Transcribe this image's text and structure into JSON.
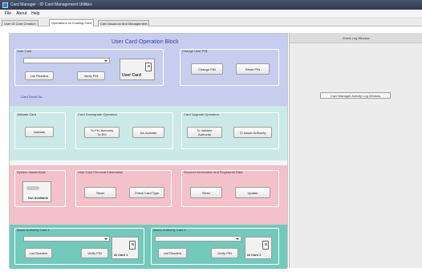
{
  "window": {
    "title": "Card Manager - ID Card Management Utilities"
  },
  "menu": [
    "File",
    "About",
    "Help"
  ],
  "tabs": [
    {
      "label": "User ID Card Creation"
    },
    {
      "label": "Operations on Existing Card"
    },
    {
      "label": "Card Issuance And Management"
    }
  ],
  "user_block": {
    "heading": "User Card Operation Block",
    "user_card_group": "User Card",
    "card_reader_value": "",
    "list_readers": "List Readers",
    "verify_pin": "Verify PIN",
    "card_image_label": "User Card",
    "card_serial": "Card Serial No.",
    "change_pin_group": "Change User PIN",
    "change_pin": "Change PIN",
    "reset_pin": "Reset PIN"
  },
  "validate_block": {
    "validate_group": "Validate Card",
    "validate": "Validate",
    "downgrade_group": "Card Downgrade Operation",
    "to_ra": "To PKI Authority\nTo RO",
    "deactivate": "De-Activate",
    "upgrade_group": "Card Upgrade Operation",
    "to_validate_authority": "To Validate\nAuthority",
    "to_issuer_authority": "To Issuer Authority"
  },
  "info_block": {
    "master_keys_group": "System MasterKeys",
    "key_label": "Not Available",
    "personal_info_group": "User Card Personal Information",
    "read": "Read",
    "check_card_type": "Check Card Type",
    "secured_group": "Secured Information and Fingerprint Data",
    "read2": "Read",
    "update": "Update"
  },
  "issuer_block": {
    "card1_group": "Issuer Authority Card 1",
    "card1_list_readers": "List Readers",
    "card1_verify_pin": "Verify PIN",
    "card1_image_label": "IA Card 1",
    "card2_group": "Issuer Authority Card 2",
    "card2_list_readers": "List Readers",
    "card2_verify_pin": "Verify PIN",
    "card2_image_label": "IA Card 2"
  },
  "log": {
    "title": "Event Log Window",
    "button": "Card Manager Activity Log Window"
  },
  "colors": {
    "blue_band": "#c7cdee",
    "teal_band": "#cbe9e7",
    "pink_band": "#f3c1c9",
    "green_band": "#73c9bb",
    "heading": "#3a3ea0"
  }
}
